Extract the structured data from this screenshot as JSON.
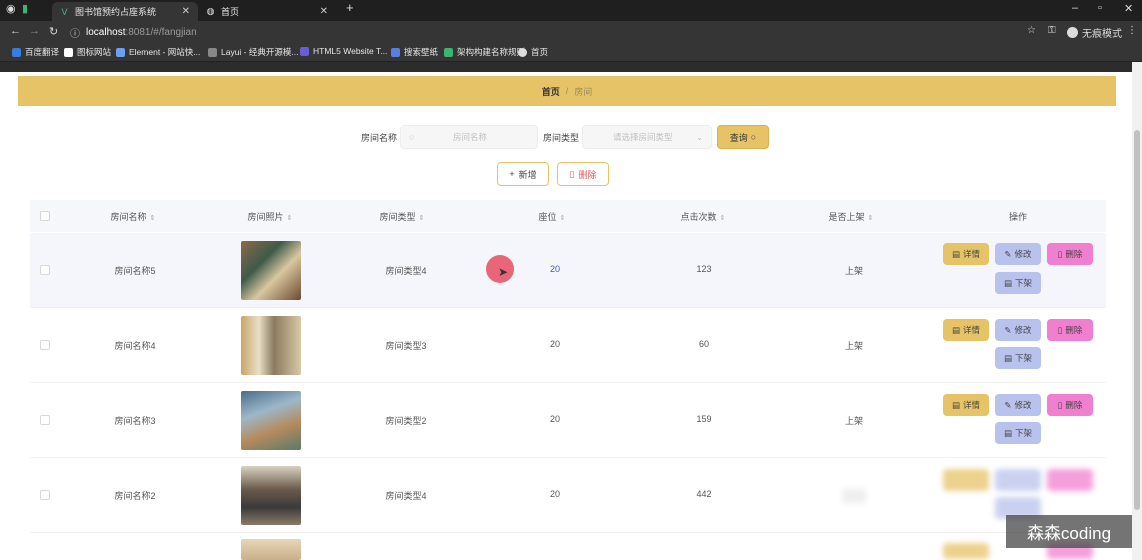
{
  "browser": {
    "tabs": [
      {
        "title": "图书馆预约占座系统",
        "active": true
      },
      {
        "title": "首页",
        "active": false
      }
    ],
    "url_host": "localhost",
    "url_rest": ":8081/#/fangjian",
    "profile_label": "无痕模式",
    "bookmarks": [
      "百度翻译",
      "图标网站",
      "Element - 网站快...",
      "Layui - 经典开源模...",
      "HTML5 Website T...",
      "搜索壁纸",
      "架构构建名称规则",
      "首页"
    ],
    "bookmark_colors": [
      "#3b7bdc",
      "#ffffff",
      "#6aa0f0",
      "#888888",
      "#6a5bd6",
      "#5a7fe0",
      "#3cb371",
      "#dddddd"
    ]
  },
  "breadcrumb": {
    "home": "首页",
    "separator": "/",
    "current": "房间"
  },
  "search": {
    "name_label": "房间名称",
    "name_placeholder": "房间名称",
    "type_label": "房间类型",
    "type_placeholder": "请选择房间类型",
    "query_button": "查询"
  },
  "actions": {
    "add": "新增",
    "delete": "删除"
  },
  "table": {
    "headers": [
      "房间名称",
      "房间照片",
      "房间类型",
      "座位",
      "点击次数",
      "是否上架",
      "操作"
    ],
    "rows": [
      {
        "name": "房间名称5",
        "type": "房间类型4",
        "seats": "20",
        "clicks": "123",
        "status": "上架"
      },
      {
        "name": "房间名称4",
        "type": "房间类型3",
        "seats": "20",
        "clicks": "60",
        "status": "上架"
      },
      {
        "name": "房间名称3",
        "type": "房间类型2",
        "seats": "20",
        "clicks": "159",
        "status": "上架"
      },
      {
        "name": "房间名称2",
        "type": "房间类型4",
        "seats": "20",
        "clicks": "442",
        "status": ""
      }
    ],
    "op_labels": {
      "detail": "详情",
      "edit": "修改",
      "remove": "删除",
      "off_shelf": "下架"
    }
  },
  "watermark": "森森coding",
  "colors": {
    "accent": "#e6c366",
    "edit": "#b9c2ec",
    "remove": "#f17fcf",
    "seat_text": "#3a5fae"
  }
}
